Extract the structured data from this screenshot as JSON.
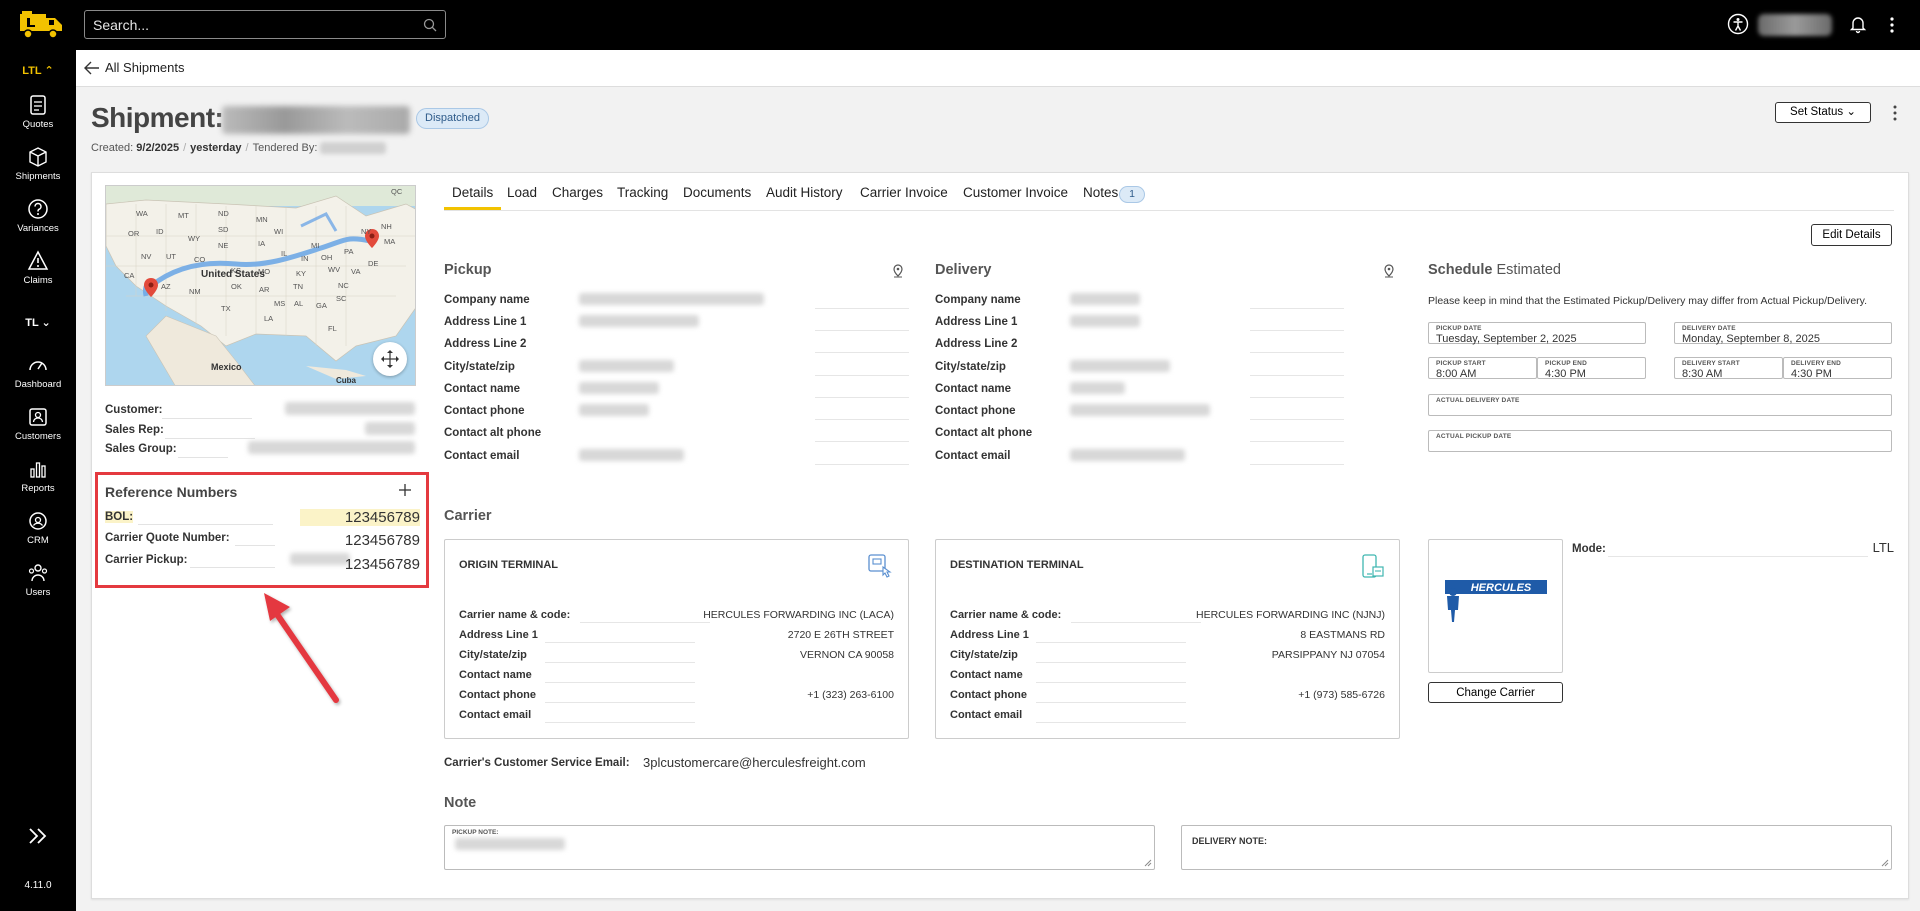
{
  "topbar": {
    "search_placeholder": "Search..."
  },
  "sidebar": {
    "group_ltl": "LTL",
    "group_tl": "TL",
    "items": [
      {
        "label": "Quotes"
      },
      {
        "label": "Shipments"
      },
      {
        "label": "Variances"
      },
      {
        "label": "Claims"
      },
      {
        "label": "Dashboard"
      },
      {
        "label": "Customers"
      },
      {
        "label": "Reports"
      },
      {
        "label": "CRM"
      },
      {
        "label": "Users"
      }
    ],
    "version": "4.11.0"
  },
  "breadcrumb": {
    "back_label": "All Shipments"
  },
  "header": {
    "title": "Shipment:",
    "status_badge": "Dispatched",
    "created_label": "Created:",
    "created_date": "9/2/2025",
    "created_relative": "yesterday",
    "tendered_label": "Tendered By:",
    "set_status_label": "Set Status"
  },
  "summary": {
    "customer_label": "Customer:",
    "sales_rep_label": "Sales Rep:",
    "sales_group_label": "Sales Group:"
  },
  "map": {
    "labels": [
      "United States",
      "Mexico",
      "Cuba"
    ],
    "states": [
      "QC",
      "WA",
      "MT",
      "ND",
      "MN",
      "OR",
      "ID",
      "SD",
      "WY",
      "WI",
      "MI",
      "NE",
      "IA",
      "NV",
      "UT",
      "CO",
      "IL",
      "IN",
      "OH",
      "PA",
      "NY",
      "NH",
      "MA",
      "CA",
      "KS",
      "MO",
      "KY",
      "WV",
      "VA",
      "DE",
      "AZ",
      "OK",
      "NM",
      "AR",
      "TN",
      "NC",
      "SC",
      "TX",
      "MS",
      "AL",
      "GA",
      "LA",
      "FL"
    ]
  },
  "reference_numbers": {
    "title": "Reference Numbers",
    "rows": [
      {
        "label": "BOL:",
        "value": "123456789"
      },
      {
        "label": "Carrier Quote Number:",
        "value": "123456789"
      },
      {
        "label": "Carrier Pickup:",
        "value": "123456789"
      }
    ]
  },
  "tabs": [
    {
      "label": "Details"
    },
    {
      "label": "Load"
    },
    {
      "label": "Charges"
    },
    {
      "label": "Tracking"
    },
    {
      "label": "Documents"
    },
    {
      "label": "Audit History"
    },
    {
      "label": "Carrier Invoice"
    },
    {
      "label": "Customer Invoice"
    },
    {
      "label": "Notes"
    }
  ],
  "notes_count": "1",
  "edit_details_label": "Edit Details",
  "pickup": {
    "title": "Pickup",
    "fields": [
      "Company name",
      "Address Line 1",
      "Address Line 2",
      "City/state/zip",
      "Contact name",
      "Contact phone",
      "Contact alt phone",
      "Contact email"
    ]
  },
  "delivery": {
    "title": "Delivery",
    "fields": [
      "Company name",
      "Address Line 1",
      "Address Line 2",
      "City/state/zip",
      "Contact name",
      "Contact phone",
      "Contact alt phone",
      "Contact email"
    ]
  },
  "schedule": {
    "title": "Schedule",
    "subtitle": "Estimated",
    "note": "Please keep in mind that the Estimated Pickup/Delivery may differ from Actual Pickup/Delivery.",
    "pickup_date_label": "PICKUP DATE",
    "pickup_date": "Tuesday, September 2, 2025",
    "delivery_date_label": "DELIVERY DATE",
    "delivery_date": "Monday, September 8, 2025",
    "pickup_start_label": "PICKUP START",
    "pickup_start": "8:00 AM",
    "pickup_end_label": "PICKUP END",
    "pickup_end": "4:30 PM",
    "delivery_start_label": "DELIVERY START",
    "delivery_start": "8:30 AM",
    "delivery_end_label": "DELIVERY END",
    "delivery_end": "4:30 PM",
    "actual_delivery_label": "ACTUAL DELIVERY DATE",
    "actual_pickup_label": "ACTUAL PICKUP DATE"
  },
  "carrier": {
    "title": "Carrier",
    "origin": {
      "title": "ORIGIN TERMINAL",
      "rows": [
        {
          "label": "Carrier name & code:",
          "value": "HERCULES FORWARDING INC (LACA)"
        },
        {
          "label": "Address Line 1",
          "value": "2720 E 26TH STREET"
        },
        {
          "label": "City/state/zip",
          "value": "VERNON CA 90058"
        },
        {
          "label": "Contact name",
          "value": ""
        },
        {
          "label": "Contact phone",
          "value": "+1 (323) 263-6100"
        },
        {
          "label": "Contact email",
          "value": ""
        }
      ]
    },
    "destination": {
      "title": "DESTINATION TERMINAL",
      "rows": [
        {
          "label": "Carrier name & code:",
          "value": "HERCULES FORWARDING INC (NJNJ)"
        },
        {
          "label": "Address Line 1",
          "value": "8 EASTMANS RD"
        },
        {
          "label": "City/state/zip",
          "value": "PARSIPPANY NJ 07054"
        },
        {
          "label": "Contact name",
          "value": ""
        },
        {
          "label": "Contact phone",
          "value": "+1 (973) 585-6726"
        },
        {
          "label": "Contact email",
          "value": ""
        }
      ]
    },
    "logo_text": "HERCULES",
    "change_carrier_label": "Change Carrier",
    "mode_label": "Mode:",
    "mode_value": "LTL",
    "cs_email_label": "Carrier's Customer Service Email:",
    "cs_email_value": "3plcustomercare@herculesfreight.com"
  },
  "note": {
    "title": "Note",
    "pickup_label": "PICKUP NOTE:",
    "delivery_label": "DELIVERY NOTE:"
  },
  "colors": {
    "accent": "#f2c200",
    "highlight_box": "#e4393f",
    "badge_bg": "#dceaf7",
    "sidebar_bg": "#000000"
  }
}
